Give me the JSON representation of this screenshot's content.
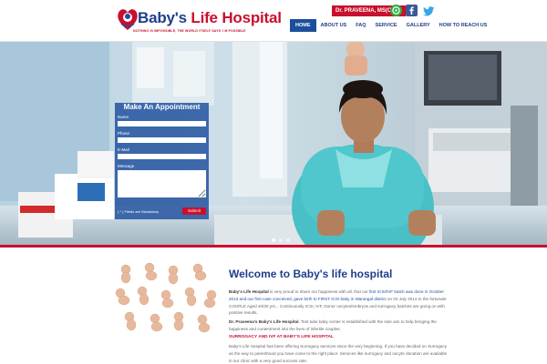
{
  "header": {
    "logo_name_part1": "Baby's ",
    "logo_name_part2": "Life Hospital",
    "logo_tagline": "NOTHING IS IMPOSSIBLE, THE WORLD ITSELF SAYS 'I M POSSIBLE",
    "doctor_badge": "Dr. PRAVEENA, MS(OBG)",
    "social_icons": [
      "whatsapp-icon",
      "facebook-icon",
      "twitter-icon"
    ],
    "nav": [
      {
        "label": "HOME",
        "active": true
      },
      {
        "label": "ABOUT US",
        "active": false
      },
      {
        "label": "FAQ",
        "active": false
      },
      {
        "label": "SERVICE",
        "active": false
      },
      {
        "label": "GALLERY",
        "active": false
      },
      {
        "label": "HOW TO REACH US",
        "active": false
      }
    ]
  },
  "appointment": {
    "title": "Make An Appointment",
    "name_label": "Name",
    "phone_label": "Phone",
    "email_label": "E-Mail",
    "message_label": "Message",
    "mandatory_note": "( * ) Fields are Mandatory",
    "submit_label": "Submit"
  },
  "slider": {
    "slide_count": 3,
    "active_slide": 1
  },
  "content": {
    "welcome_title": "Welcome to Baby's life hospital",
    "p1_bold": "Baby's Life Hospital",
    "p1_a": " is very proud to share our happiness with all, that our ",
    "p1_link": "first ICSI/IVF batch was done in October 2013 and our first case conceived, gave birth to FIRST ICSI baby in Warangal district",
    "p1_b": " on 02 July 2014 to the fortunate COUPLE Aged 40/30 yrs... Continuously ICSI, IVF, Donor oocytes/embryos and surrogacy batches are going on with positive results.",
    "p2_bold": "Dr. Praveena's Baby's Life Hospital",
    "p2_text": ", Test tube baby center is established with the sole aim to help bringing the happiness and contentment into the lives of infertile couples.",
    "subhead": "SURROGACY AND IVF AT BABY'S LIFE HOSPITAL",
    "p3_text": "Baby's Life Hospital has been offering Surrogacy services since the very beginning. If you have decided on Surrogacy as the way to parenthood you have come to the right place. Services like surrogacy and oocyte donation are available in our clinic with a very good success rate."
  },
  "colors": {
    "brand_blue": "#1d4e9c",
    "brand_red": "#c8102e"
  }
}
